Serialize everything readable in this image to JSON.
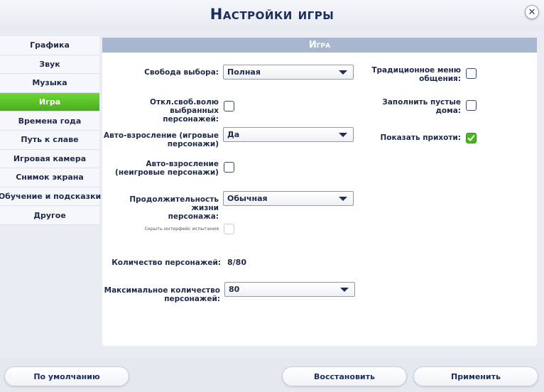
{
  "header": {
    "title": "Настройки игры"
  },
  "sidebar": {
    "items": [
      {
        "label": "Графика"
      },
      {
        "label": "Звук"
      },
      {
        "label": "Музыка"
      },
      {
        "label": "Игра"
      },
      {
        "label": "Времена года"
      },
      {
        "label": "Путь к славе"
      },
      {
        "label": "Игровая камера"
      },
      {
        "label": "Снимок экрана"
      },
      {
        "label": "Обучение и подсказки"
      },
      {
        "label": "Другое"
      }
    ],
    "active": "Игра"
  },
  "panel": {
    "title": "Игра",
    "free_will": {
      "label": "Свобода выбора:",
      "value": "Полная"
    },
    "disable_free_will": {
      "label_1": "Откл.своб.волю выбранных",
      "label_2": "персонажей:",
      "checked": false
    },
    "auto_aging_played": {
      "label_1": "Авто-взросление (игровые",
      "label_2": "персонажи)",
      "value": "Да"
    },
    "auto_aging_unplayed": {
      "label_1": "Авто-взросление",
      "label_2": "(неигровые персонажи)",
      "checked": false
    },
    "lifespan": {
      "label_1": "Продолжительность жизни",
      "label_2": "персонажа:",
      "value": "Обычная"
    },
    "hide_challenge_ui": {
      "label": "Скрыть интерфейс испытания",
      "checked": false,
      "disabled": true
    },
    "sim_count": {
      "label": "Количество персонажей:",
      "value": "8/80"
    },
    "max_sims": {
      "label_1": "Максимальное количество",
      "label_2": "персонажей:",
      "value": "80"
    },
    "classic_menu": {
      "label_1": "Традиционное меню",
      "label_2": "общения:",
      "checked": false
    },
    "fill_empty_houses": {
      "label_1": "Заполнить пустые",
      "label_2": "дома:",
      "checked": false
    },
    "show_whims": {
      "label": "Показать прихоти:",
      "checked": true
    }
  },
  "footer": {
    "default_label": "По умолчанию",
    "restore_label": "Восстановить",
    "apply_label": "Применить"
  },
  "colors": {
    "active_tab": "#4aae1c",
    "panel_header": "#a9b6cf",
    "checked": "#49b520"
  }
}
